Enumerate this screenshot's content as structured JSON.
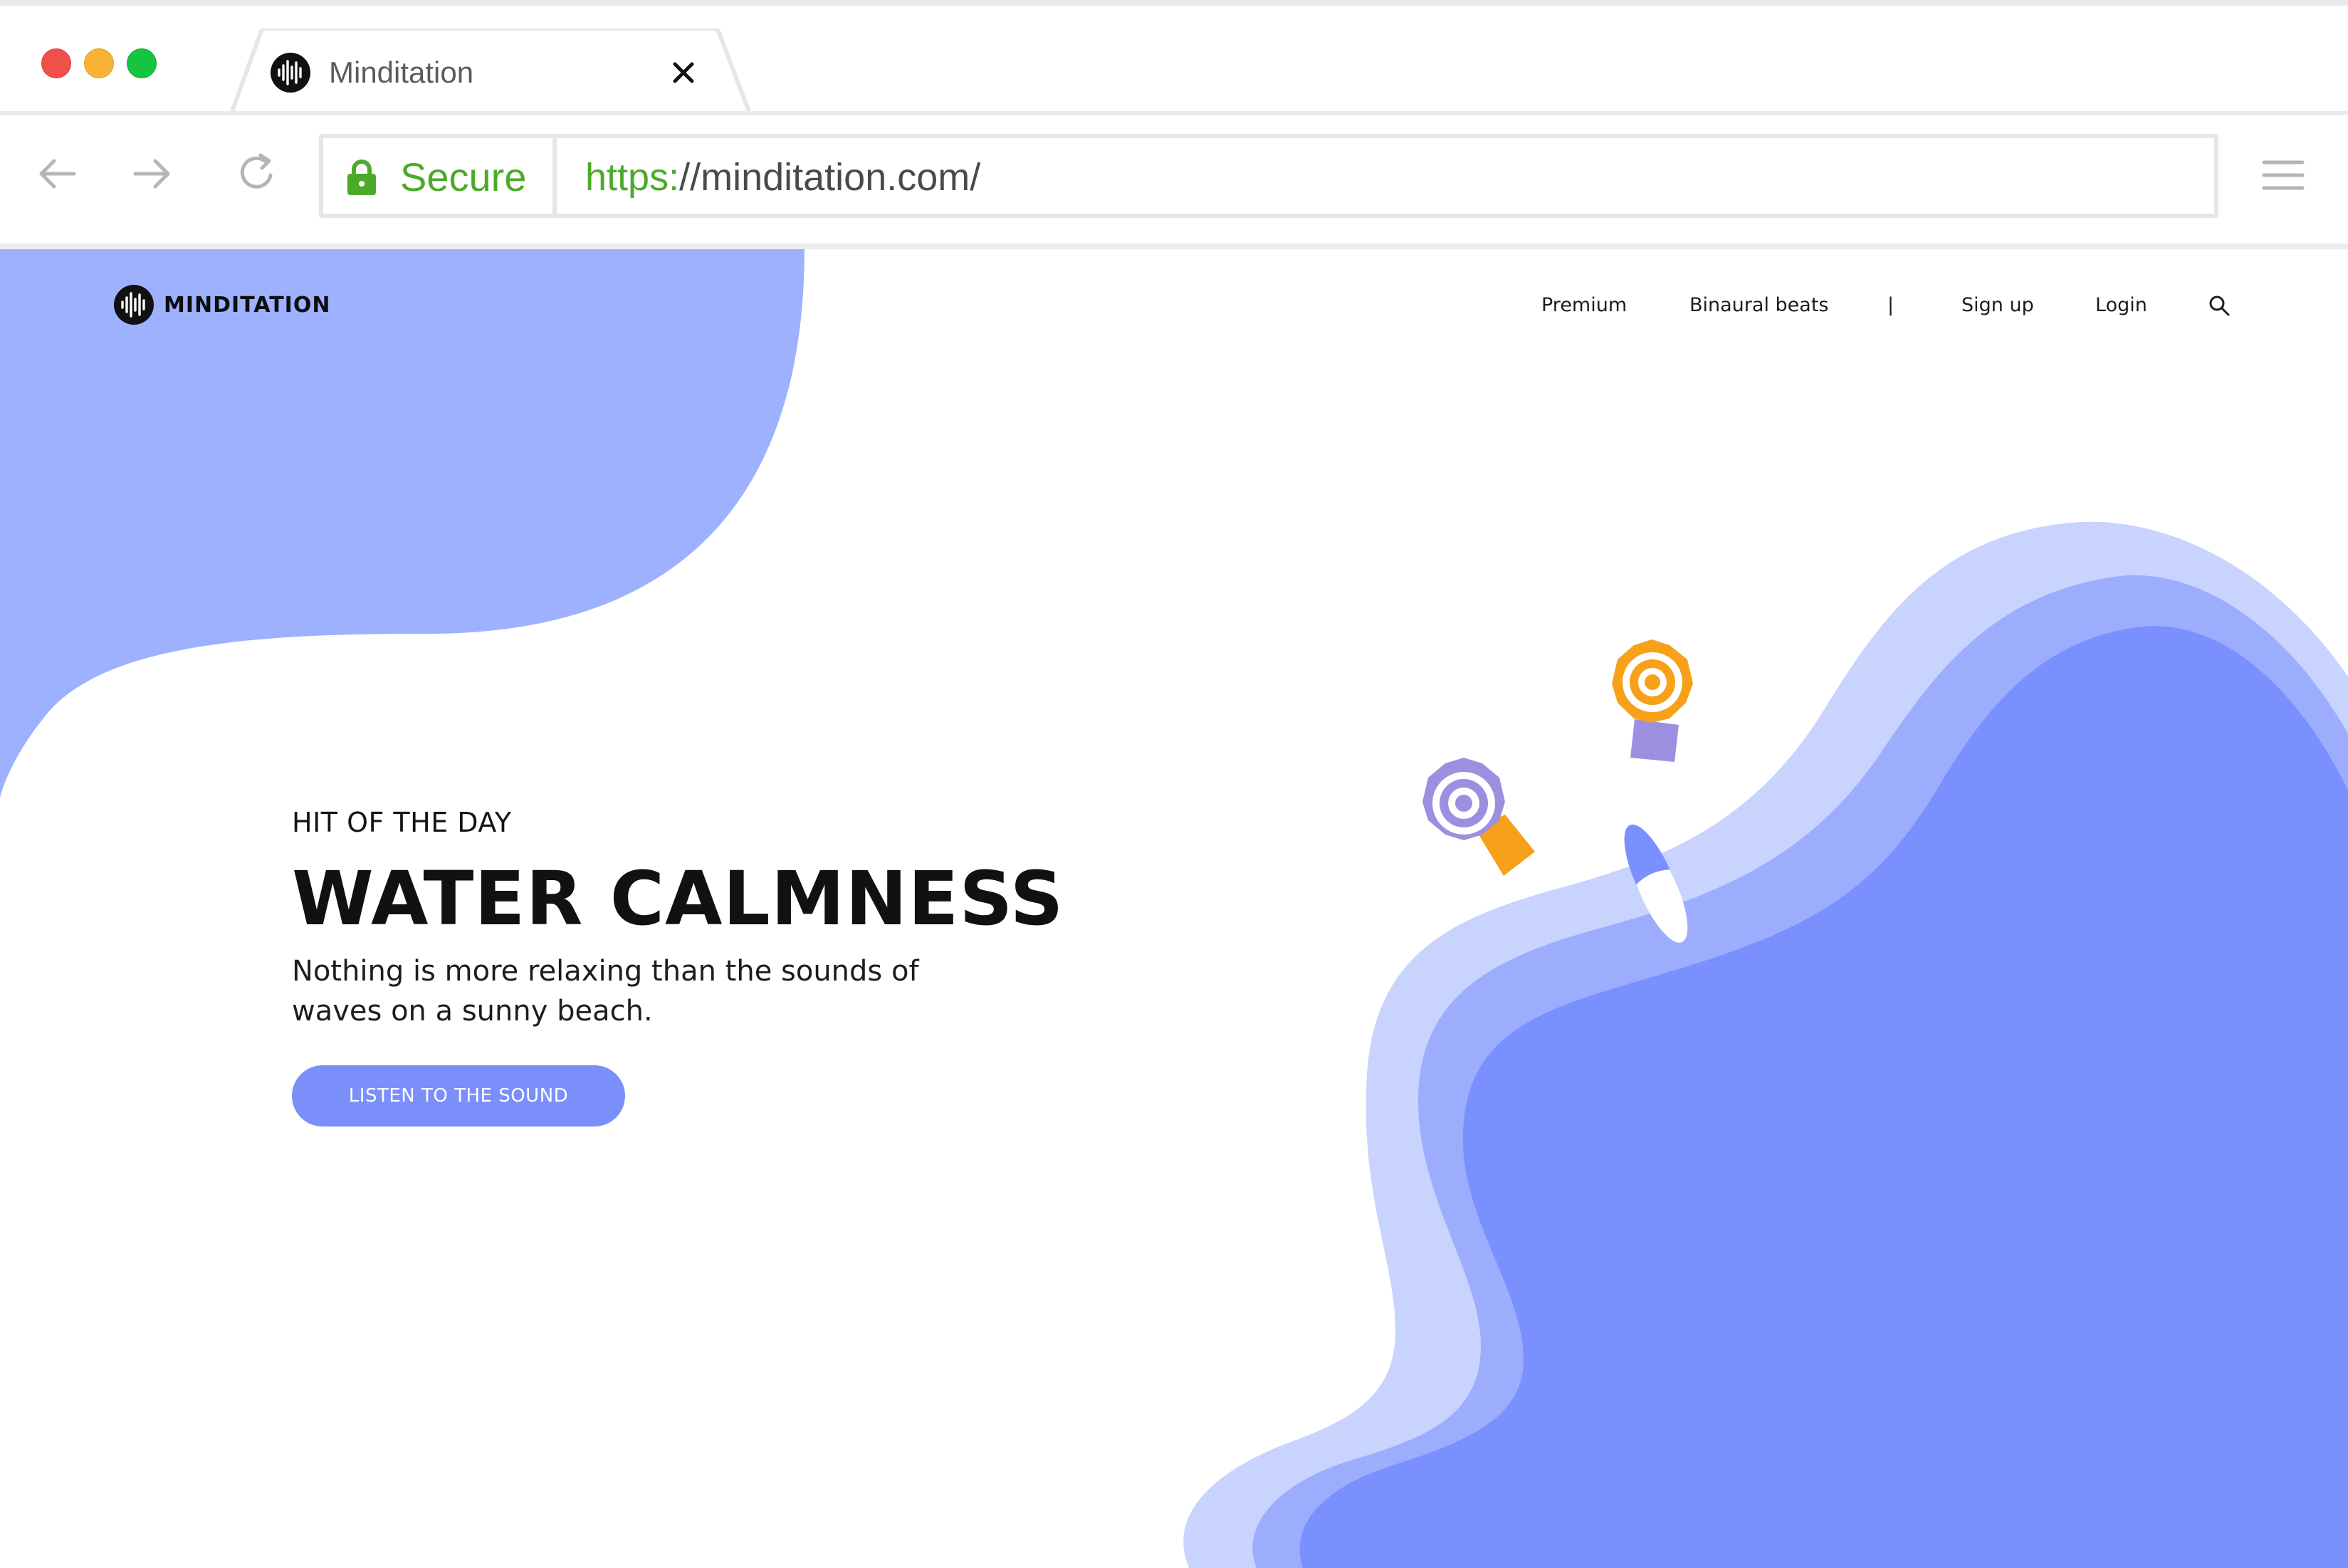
{
  "window": {
    "controls": [
      "close",
      "minimize",
      "maximize"
    ]
  },
  "tab": {
    "title": "Minditation",
    "icon": "minditation-logo-icon",
    "close_icon": "close-icon"
  },
  "toolbar": {
    "back_icon": "back-arrow-icon",
    "forward_icon": "forward-arrow-icon",
    "reload_icon": "reload-icon",
    "menu_icon": "hamburger-menu-icon"
  },
  "address_bar": {
    "security_label": "Secure",
    "url_scheme": "https:",
    "url_rest": "//minditation.com/"
  },
  "site": {
    "brand": "MINDITATION",
    "nav": {
      "premium": "Premium",
      "binaural": "Binaural beats",
      "separator": "|",
      "signup": "Sign up",
      "login": "Login"
    }
  },
  "hero": {
    "eyebrow": "HIT OF THE DAY",
    "title": "WATER CALMNESS",
    "description": "Nothing is more relaxing than the sounds of waves on a sunny beach.",
    "cta_label": "LISTEN TO THE SOUND"
  },
  "colors": {
    "accent": "#7b8ffb",
    "blob_left": "#9eb1fe",
    "wave_light": "#c8d3fe",
    "wave_mid": "#9cadfe",
    "wave_dark": "#7a90fe",
    "secure_green": "#4caa2a",
    "umbrella_orange": "#f7a11a",
    "umbrella_purple": "#9b8fe0"
  }
}
